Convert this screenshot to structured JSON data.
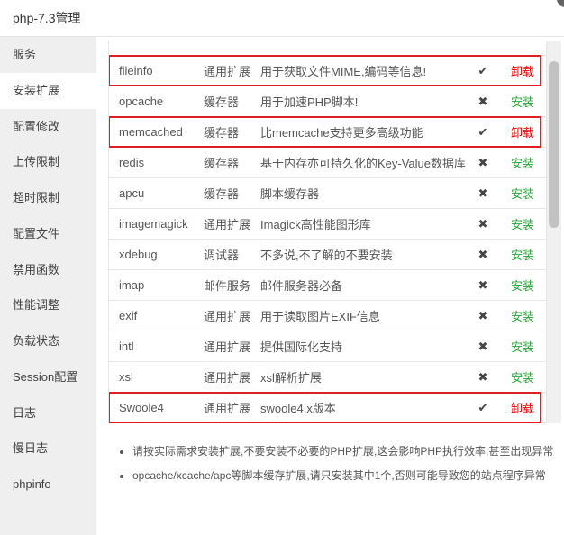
{
  "header": {
    "title": "php-7.3管理"
  },
  "sidebar": {
    "items": [
      {
        "label": "服务"
      },
      {
        "label": "安装扩展",
        "active": true
      },
      {
        "label": "配置修改"
      },
      {
        "label": "上传限制"
      },
      {
        "label": "超时限制"
      },
      {
        "label": "配置文件"
      },
      {
        "label": "禁用函数"
      },
      {
        "label": "性能调整"
      },
      {
        "label": "负载状态"
      },
      {
        "label": "Session配置"
      },
      {
        "label": "日志"
      },
      {
        "label": "慢日志"
      },
      {
        "label": "phpinfo"
      }
    ]
  },
  "table": {
    "rows": [
      {
        "name": "fileinfo",
        "type": "通用扩展",
        "desc": "用于获取文件MIME,编码等信息!",
        "status_icon": "✔",
        "action": "卸载",
        "installed": true,
        "highlighted": true
      },
      {
        "name": "opcache",
        "type": "缓存器",
        "desc": "用于加速PHP脚本!",
        "status_icon": "✖",
        "action": "安装",
        "installed": false,
        "highlighted": false
      },
      {
        "name": "memcached",
        "type": "缓存器",
        "desc": "比memcache支持更多高级功能",
        "status_icon": "✔",
        "action": "卸载",
        "installed": true,
        "highlighted": true
      },
      {
        "name": "redis",
        "type": "缓存器",
        "desc": "基于内存亦可持久化的Key-Value数据库",
        "status_icon": "✖",
        "action": "安装",
        "installed": false,
        "highlighted": false
      },
      {
        "name": "apcu",
        "type": "缓存器",
        "desc": "脚本缓存器",
        "status_icon": "✖",
        "action": "安装",
        "installed": false,
        "highlighted": false
      },
      {
        "name": "imagemagick",
        "type": "通用扩展",
        "desc": "Imagick高性能图形库",
        "status_icon": "✖",
        "action": "安装",
        "installed": false,
        "highlighted": false
      },
      {
        "name": "xdebug",
        "type": "调试器",
        "desc": "不多说,不了解的不要安装",
        "status_icon": "✖",
        "action": "安装",
        "installed": false,
        "highlighted": false
      },
      {
        "name": "imap",
        "type": "邮件服务",
        "desc": "邮件服务器必备",
        "status_icon": "✖",
        "action": "安装",
        "installed": false,
        "highlighted": false
      },
      {
        "name": "exif",
        "type": "通用扩展",
        "desc": "用于读取图片EXIF信息",
        "status_icon": "✖",
        "action": "安装",
        "installed": false,
        "highlighted": false
      },
      {
        "name": "intl",
        "type": "通用扩展",
        "desc": "提供国际化支持",
        "status_icon": "✖",
        "action": "安装",
        "installed": false,
        "highlighted": false
      },
      {
        "name": "xsl",
        "type": "通用扩展",
        "desc": "xsl解析扩展",
        "status_icon": "✖",
        "action": "安装",
        "installed": false,
        "highlighted": false
      },
      {
        "name": "Swoole4",
        "type": "通用扩展",
        "desc": "swoole4.x版本",
        "status_icon": "✔",
        "action": "卸载",
        "installed": true,
        "highlighted": true
      }
    ]
  },
  "notes": [
    "请按实际需求安装扩展,不要安装不必要的PHP扩展,这会影响PHP执行效率,甚至出现异常",
    "opcache/xcache/apc等脚本缓存扩展,请只安装其中1个,否则可能导致您的站点程序异常"
  ],
  "colors": {
    "install-green": "#2aa53a",
    "uninstall-red": "#ea0000",
    "highlight-red": "#e02020"
  }
}
